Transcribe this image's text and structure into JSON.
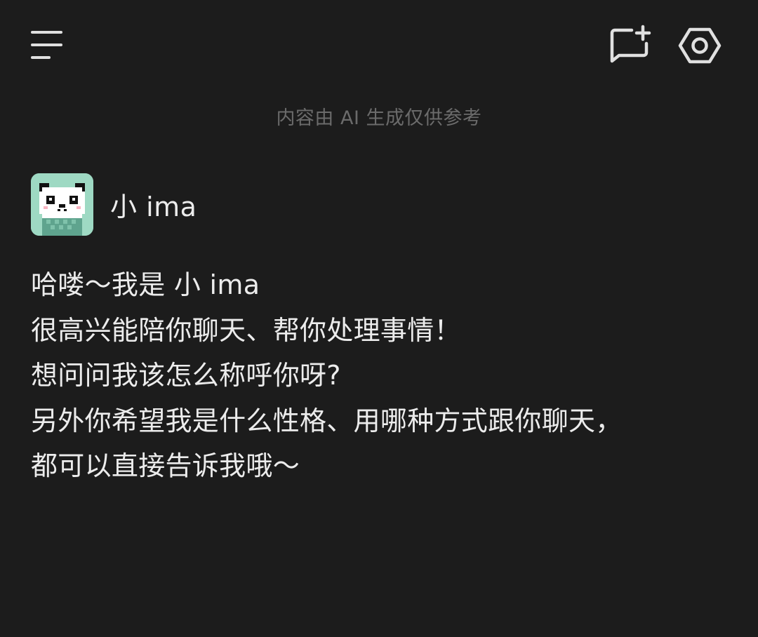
{
  "header": {
    "menu_icon": "menu-icon",
    "new_chat_icon": "new-chat-icon",
    "settings_icon": "settings-icon"
  },
  "disclaimer": "内容由 AI 生成仅供参考",
  "bot": {
    "avatar_icon": "panda-avatar",
    "name": "小 ima"
  },
  "message": {
    "lines": [
      "哈喽～我是 小 ima",
      "很高兴能陪你聊天、帮你处理事情！",
      "想问问我该怎么称呼你呀?",
      "另外你希望我是什么性格、用哪种方式跟你聊天，",
      "都可以直接告诉我哦～"
    ]
  },
  "colors": {
    "background": "#1c1c1c",
    "text": "#ececec",
    "muted": "#6b6b6b",
    "avatar_bg": "#9ed9c3"
  }
}
